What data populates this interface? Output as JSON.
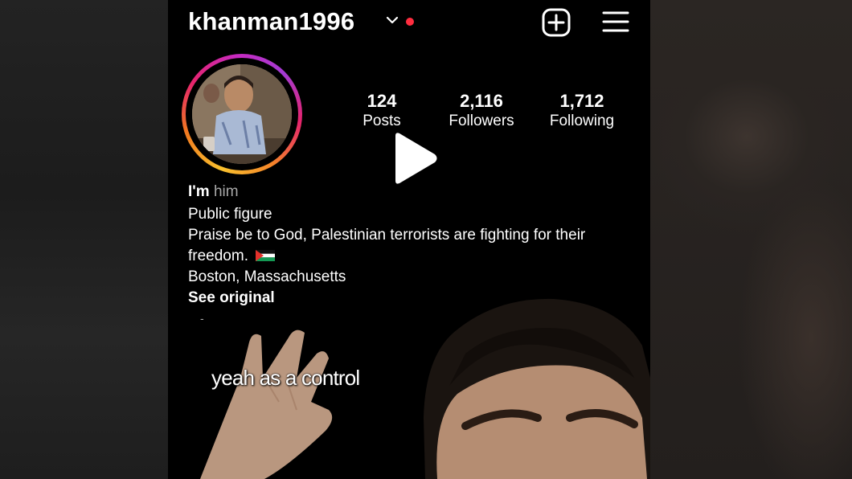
{
  "profile": {
    "username": "khanman1996",
    "stats": [
      {
        "value": "124",
        "label": "Posts"
      },
      {
        "value": "2,116",
        "label": "Followers"
      },
      {
        "value": "1,712",
        "label": "Following"
      }
    ],
    "pronoun_prefix": "I'm",
    "pronoun": "him",
    "category": "Public figure",
    "bio_line1": "Praise be to God, Palestinian terrorists are fighting for their",
    "bio_line2": "freedom.",
    "location": "Boston, Massachusetts",
    "see_original": "See original",
    "dash": "-"
  },
  "video": {
    "caption": "yeah as a control"
  },
  "icons": {
    "create": "plus-square-icon",
    "menu": "hamburger-menu-icon",
    "play": "play-icon",
    "flag": "palestine-flag-icon"
  },
  "colors": {
    "notification_dot": "#ff2d3f",
    "ring_start": "#f9c12e",
    "ring_end": "#c72ac0"
  }
}
